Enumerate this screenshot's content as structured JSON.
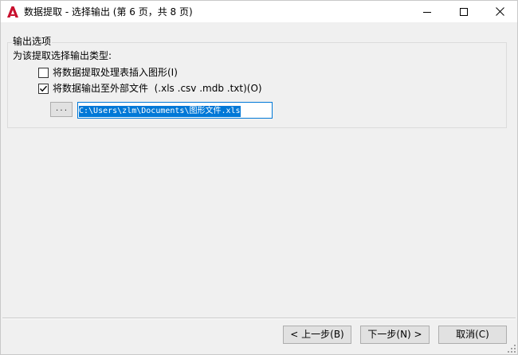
{
  "window": {
    "title": "数据提取 - 选择输出 (第 6 页，共 8 页)",
    "icon": "autocad-a-icon",
    "accent_color": "#c8102e"
  },
  "output_group": {
    "title": "输出选项",
    "description": "为该提取选择输出类型:",
    "options": [
      {
        "label": "将数据提取处理表插入图形(I)",
        "checked": false
      },
      {
        "label": "将数据输出至外部文件  (.xls .csv .mdb .txt)(O)",
        "checked": true
      }
    ],
    "browse_label": "...",
    "file_path": "C:\\Users\\zlm\\Documents\\图形文件.xls"
  },
  "footer": {
    "back_label": "< 上一步(B)",
    "next_label": "下一步(N) >",
    "cancel_label": "取消(C)"
  }
}
